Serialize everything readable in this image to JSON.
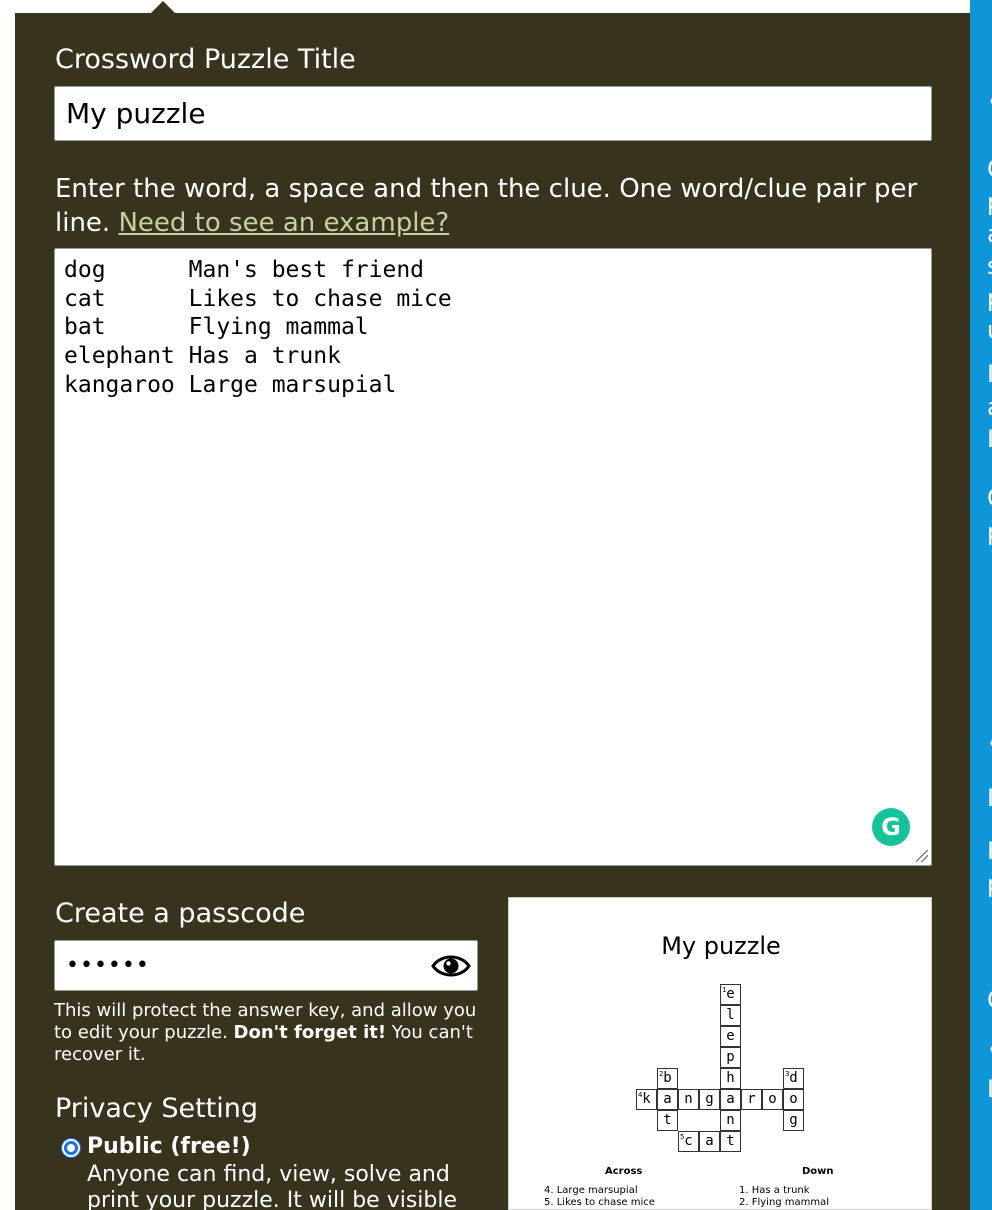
{
  "form": {
    "title_label": "Crossword Puzzle Title",
    "title_value": "My puzzle",
    "instructions_text": "Enter the word, a space and then the clue. One word/clue pair per line.",
    "example_link": "Need to see an example?",
    "word_lines": [
      "dog      Man's best friend",
      "cat      Likes to chase mice",
      "bat      Flying mammal",
      "elephant Has a trunk",
      "kangaroo Large marsupial"
    ],
    "grammarly_icon": "grammarly-icon",
    "passcode_label": "Create a passcode",
    "passcode_value": "••••••",
    "eye_icon": "eye-icon",
    "passcode_help_pre": "This will protect the answer key, and allow you to edit your puzzle.",
    "passcode_help_bold": "Don't forget it!",
    "passcode_help_post": "You can't recover it.",
    "privacy_label": "Privacy Setting",
    "privacy_option_label": "Public (free!)",
    "privacy_option_desc": "Anyone can find, view, solve and print your puzzle. It will be visible"
  },
  "preview": {
    "title": "My puzzle",
    "across_heading": "Across",
    "down_heading": "Down",
    "across_clues": [
      "4. Large marsupial",
      "5. Likes to chase mice"
    ],
    "down_clues": [
      "1. Has a trunk",
      "2. Flying mammal"
    ]
  },
  "crossword": {
    "cells": [
      {
        "r": 0,
        "c": 4,
        "ch": "e",
        "n": "1"
      },
      {
        "r": 1,
        "c": 4,
        "ch": "l"
      },
      {
        "r": 2,
        "c": 4,
        "ch": "e"
      },
      {
        "r": 3,
        "c": 4,
        "ch": "p"
      },
      {
        "r": 4,
        "c": 1,
        "ch": "b",
        "n": "2"
      },
      {
        "r": 4,
        "c": 4,
        "ch": "h"
      },
      {
        "r": 4,
        "c": 7,
        "ch": "d",
        "n": "3"
      },
      {
        "r": 5,
        "c": 0,
        "ch": "k",
        "n": "4"
      },
      {
        "r": 5,
        "c": 1,
        "ch": "a"
      },
      {
        "r": 5,
        "c": 2,
        "ch": "n"
      },
      {
        "r": 5,
        "c": 3,
        "ch": "g"
      },
      {
        "r": 5,
        "c": 4,
        "ch": "a"
      },
      {
        "r": 5,
        "c": 5,
        "ch": "r"
      },
      {
        "r": 5,
        "c": 6,
        "ch": "o"
      },
      {
        "r": 5,
        "c": 7,
        "ch": "o"
      },
      {
        "r": 6,
        "c": 1,
        "ch": "t"
      },
      {
        "r": 6,
        "c": 4,
        "ch": "n"
      },
      {
        "r": 6,
        "c": 7,
        "ch": "g"
      },
      {
        "r": 7,
        "c": 2,
        "ch": "c",
        "n": "5"
      },
      {
        "r": 7,
        "c": 3,
        "ch": "a"
      },
      {
        "r": 7,
        "c": 4,
        "ch": "t"
      }
    ]
  },
  "sidebar_fragments": [
    "•",
    "C",
    "p",
    "a",
    "s",
    "p",
    "u",
    "I",
    "a",
    "I",
    "C",
    "p",
    "•",
    "I",
    "F",
    "p",
    "C",
    "•",
    "I"
  ]
}
